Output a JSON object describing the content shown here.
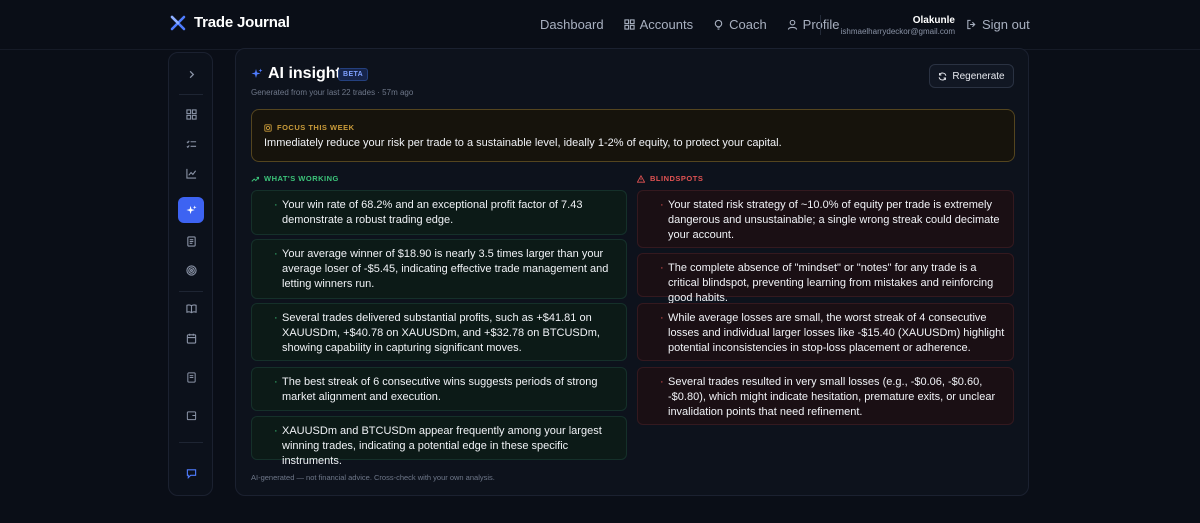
{
  "app": {
    "name": "Trade Journal"
  },
  "nav": {
    "items": [
      {
        "label": "Dashboard",
        "icon": "none"
      },
      {
        "label": "Accounts",
        "icon": "grid-icon"
      },
      {
        "label": "Coach",
        "icon": "lightbulb-icon"
      },
      {
        "label": "Profile",
        "icon": "user-icon"
      }
    ],
    "user_name": "Olakunle",
    "user_email": "ishmaelharrydeckor@gmail.com",
    "signout_label": "Sign out"
  },
  "sidebar": {
    "icons": [
      "chevron-right-icon",
      "dashboard-grid-icon",
      "checklist-icon",
      "chart-line-icon",
      "sparkles-icon",
      "journal-icon",
      "target-icon",
      "book-open-icon",
      "calendar-icon",
      "notes-icon",
      "wallet-icon",
      "chat-icon"
    ],
    "active": "sparkles-icon"
  },
  "insights": {
    "title": "AI insights",
    "badge": "BETA",
    "subtitle": "Generated from your last 22 trades · 57m ago",
    "regenerate_label": "Regenerate",
    "focus": {
      "label": "FOCUS THIS WEEK",
      "text": "Immediately reduce your risk per trade to a sustainable level, ideally 1-2% of equity, to protect your capital."
    },
    "working": {
      "label": "WHAT'S WORKING",
      "items": [
        "Your win rate of 68.2% and an exceptional profit factor of 7.43 demonstrate a robust trading edge.",
        "Your average winner of $18.90 is nearly 3.5 times larger than your average loser of -$5.45, indicating effective trade management and letting winners run.",
        "Several trades delivered substantial profits, such as +$41.81 on XAUUSDm, +$40.78 on XAUUSDm, and +$32.78 on BTCUSDm, showing capability in capturing significant moves.",
        "The best streak of 6 consecutive wins suggests periods of strong market alignment and execution.",
        "XAUUSDm and BTCUSDm appear frequently among your largest winning trades, indicating a potential edge in these specific instruments."
      ]
    },
    "blindspots": {
      "label": "BLINDSPOTS",
      "items": [
        "Your stated risk strategy of ~10.0% of equity per trade is extremely dangerous and unsustainable; a single wrong streak could decimate your account.",
        "The complete absence of \"mindset\" or \"notes\" for any trade is a critical blindspot, preventing learning from mistakes and reinforcing good habits.",
        "While average losses are small, the worst streak of 4 consecutive losses and individual larger losses like -$15.40 (XAUUSDm) highlight potential inconsistencies in stop-loss placement or adherence.",
        "Several trades resulted in very small losses (e.g., -$0.06, -$0.60, -$0.80), which might indicate hesitation, premature exits, or unclear invalidation points that need refinement."
      ]
    },
    "footnote": "AI-generated — not financial advice. Cross-check with your own analysis."
  },
  "colors": {
    "accent": "#3d63f2",
    "good": "#3cc47a",
    "bad": "#e05252",
    "focus": "#c99b3a"
  }
}
